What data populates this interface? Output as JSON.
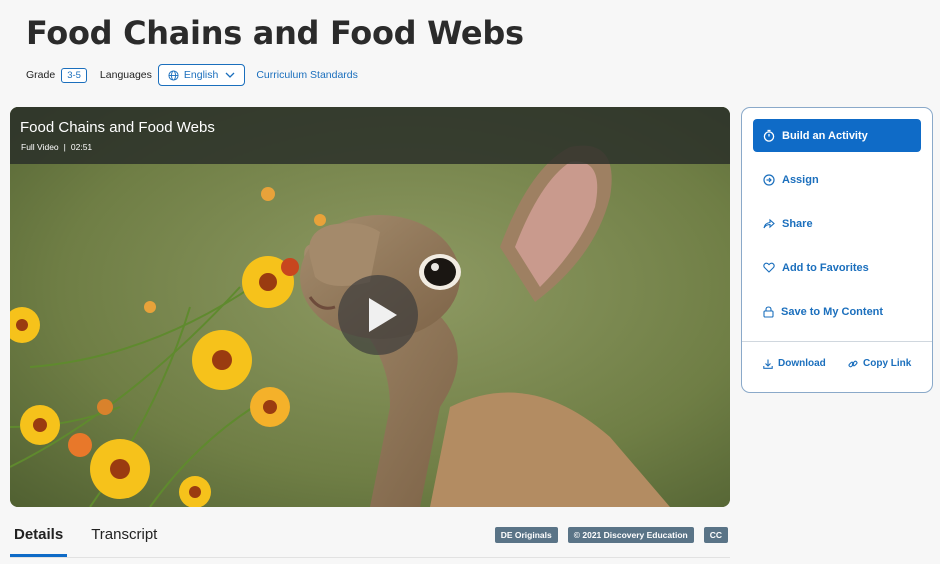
{
  "page": {
    "title": "Food Chains and Food Webs"
  },
  "meta": {
    "grade_label": "Grade",
    "grade_value": "3-5",
    "languages_label": "Languages",
    "language_selected": "English",
    "curriculum_link": "Curriculum Standards"
  },
  "video": {
    "title": "Food Chains and Food Webs",
    "type_label": "Full Video",
    "separator": "|",
    "duration": "02:51"
  },
  "actions": {
    "build_activity": "Build an Activity",
    "assign": "Assign",
    "share": "Share",
    "add_favorites": "Add to Favorites",
    "save_content": "Save to My Content",
    "download": "Download",
    "copy_link": "Copy Link"
  },
  "tabs": [
    {
      "label": "Details",
      "active": true
    },
    {
      "label": "Transcript",
      "active": false
    }
  ],
  "badges": [
    "DE Originals",
    "© 2021 Discovery Education",
    "CC"
  ],
  "colors": {
    "accent": "#0f6bc7",
    "link": "#1b6fbd",
    "badge_bg": "#5a7487"
  }
}
